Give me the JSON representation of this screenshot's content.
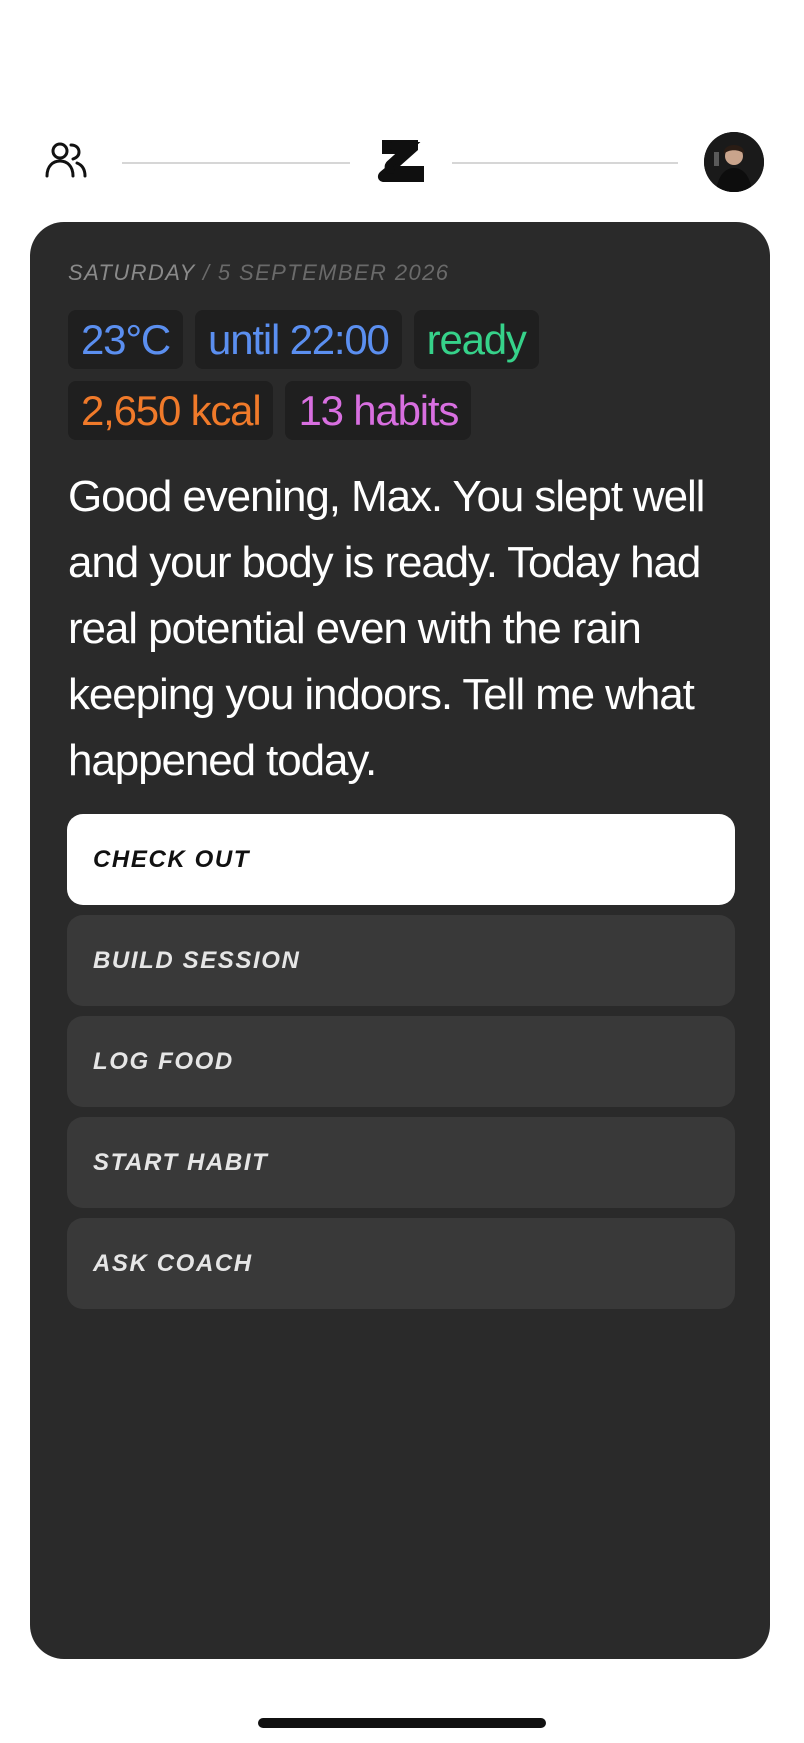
{
  "header": {
    "friends_icon": "people-icon",
    "logo_icon": "app-logo",
    "avatar": "user-avatar"
  },
  "card": {
    "day": "SATURDAY",
    "separator": "/",
    "date": "5 SEPTEMBER 2026",
    "chips": {
      "temperature": "23°C",
      "until": "until 22:00",
      "readiness": "ready",
      "kcal": "2,650 kcal",
      "habits": "13 habits"
    },
    "greeting": "Good evening, Max. You slept well and your body is ready. Today had real potential even with the rain keeping you indoors. Tell me what happened today.",
    "actions": [
      "CHECK OUT",
      "BUILD SESSION",
      "LOG FOOD",
      "START HABIT",
      "ASK COACH"
    ]
  },
  "colors": {
    "card_bg": "#2a2a2a",
    "chip_blue": "#5b8ff0",
    "chip_green": "#36d28a",
    "chip_orange": "#f07a2a",
    "chip_pink": "#d86fe0"
  }
}
